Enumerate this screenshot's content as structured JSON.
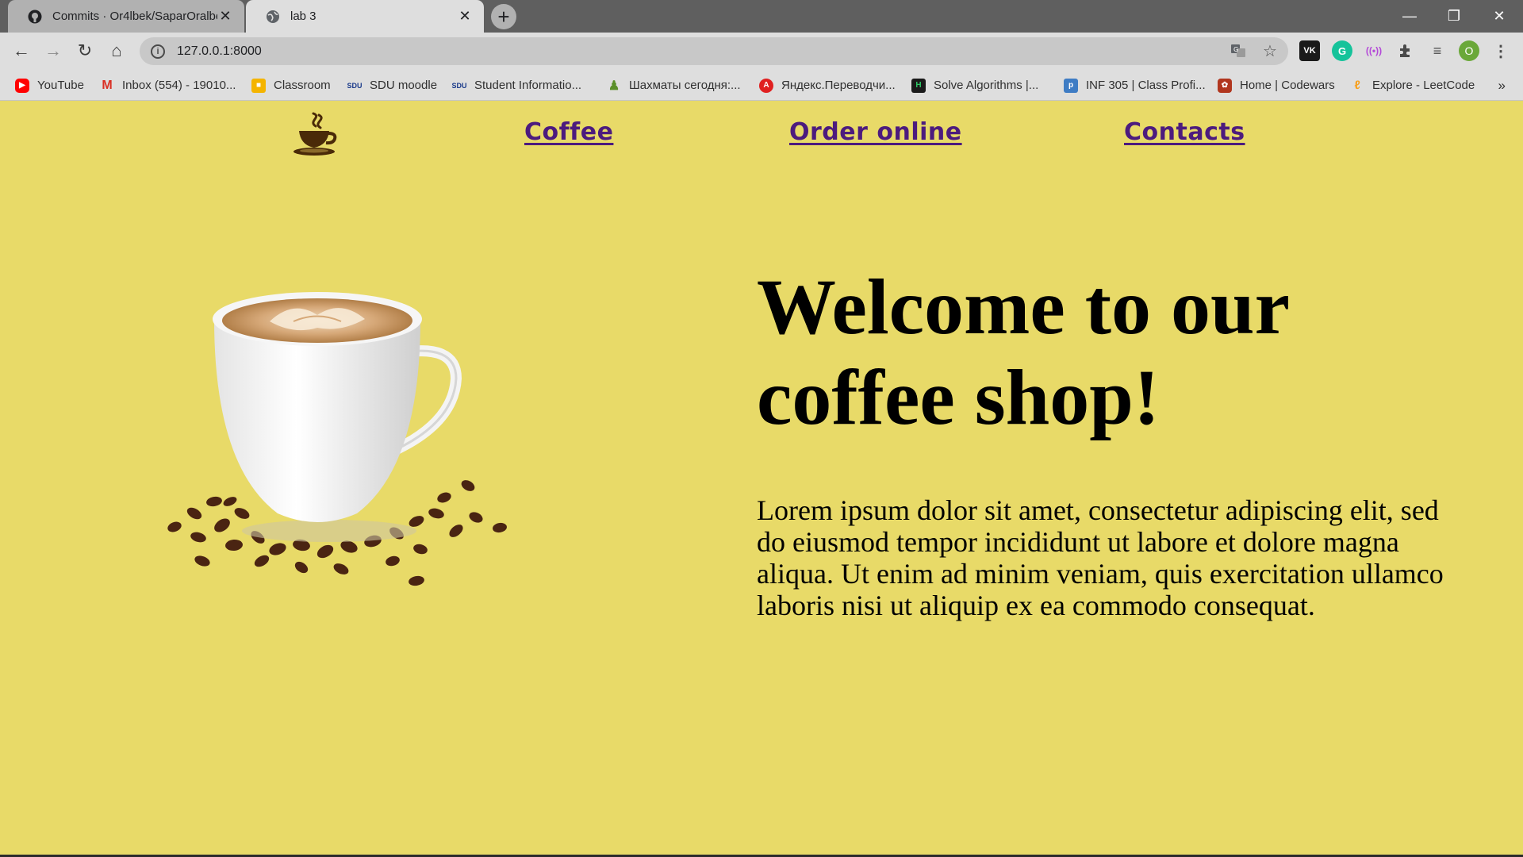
{
  "browser": {
    "tabs": [
      {
        "title": "Commits · Or4lbek/SaparOralbek",
        "icon": "github-icon",
        "active": false
      },
      {
        "title": "lab 3",
        "icon": "globe-icon",
        "active": true
      }
    ],
    "url": "127.0.0.1:8000",
    "profile_initial": "O",
    "bookmarks": [
      {
        "label": "YouTube",
        "icon": "youtube-icon",
        "color": "#ff0000"
      },
      {
        "label": "Inbox (554) - 19010...",
        "icon": "gmail-icon",
        "color": "#d93025"
      },
      {
        "label": "Classroom",
        "icon": "classroom-icon",
        "color": "#f4b400"
      },
      {
        "label": "SDU moodle",
        "icon": "sdu-icon",
        "color": "#1a3a8a"
      },
      {
        "label": "Student Informatio...",
        "icon": "sdu-portal-icon",
        "color": "#1a3a8a"
      },
      {
        "label": "Шахматы сегодня:...",
        "icon": "chess-icon",
        "color": "#5a8f29"
      },
      {
        "label": "Яндекс.Переводчи...",
        "icon": "yandex-translate-icon",
        "color": "#e02020"
      },
      {
        "label": "Solve Algorithms |...",
        "icon": "hackerrank-icon",
        "color": "#1a1a1a"
      },
      {
        "label": "INF 305 | Class Profi...",
        "icon": "piazza-icon",
        "color": "#3e7cc4"
      },
      {
        "label": "Home | Codewars",
        "icon": "codewars-icon",
        "color": "#b1361e"
      },
      {
        "label": "Explore - LeetCode",
        "icon": "leetcode-icon",
        "color": "#f89f1b"
      }
    ],
    "more_bookmarks": "»"
  },
  "site": {
    "nav": {
      "coffee": "Coffee",
      "order": "Order online",
      "contacts": "Contacts"
    },
    "hero": {
      "title": "Welcome to our coffee shop!",
      "text": "Lorem ipsum dolor sit amet, consectetur adipiscing elit, sed do eiusmod tempor incididunt ut labore et dolore magna aliqua. Ut enim ad minim veniam, quis exercitation ullamco laboris nisi ut aliquip ex ea commodo consequat."
    },
    "colors": {
      "background": "#e8da68",
      "link": "#4c1b7e"
    }
  }
}
